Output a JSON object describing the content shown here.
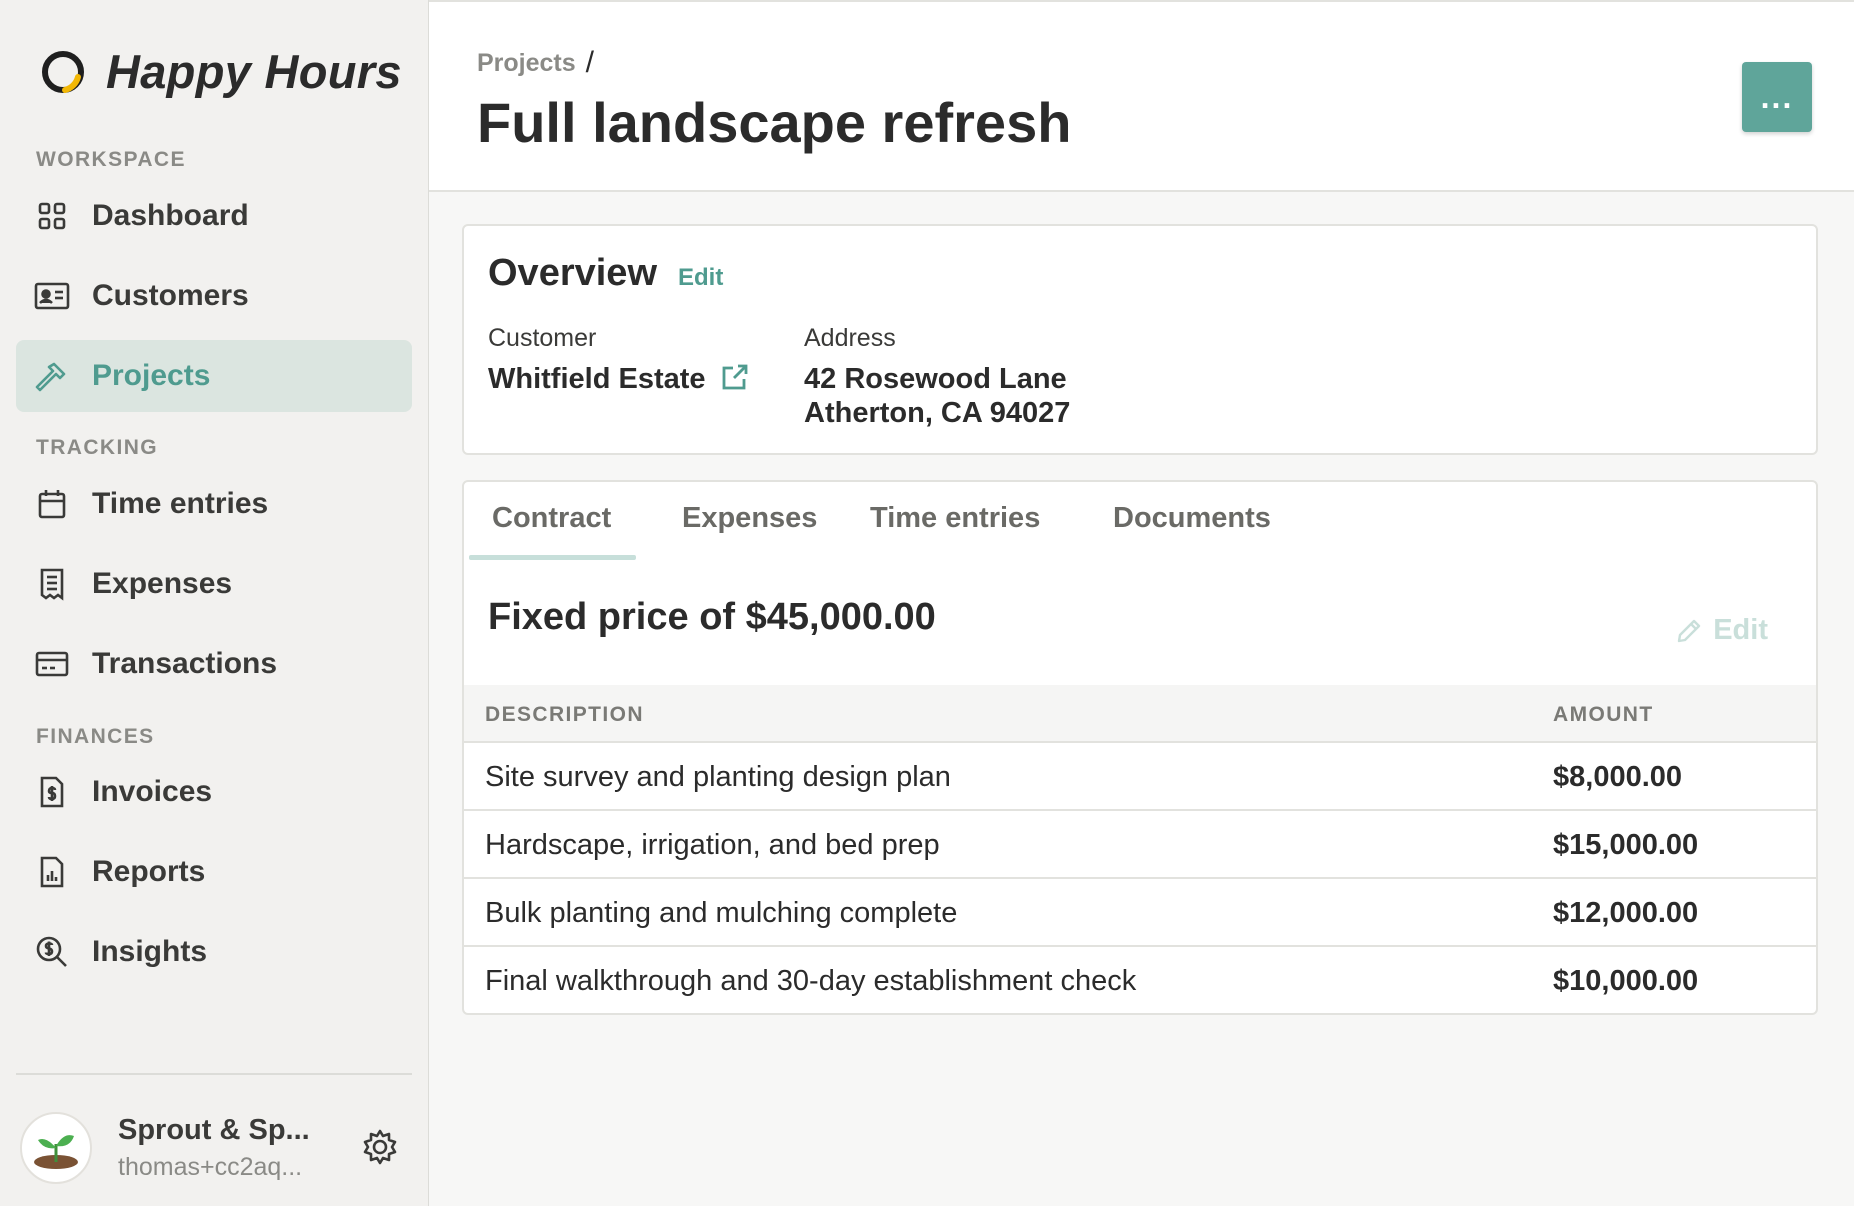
{
  "brand": {
    "name": "Happy Hours",
    "logo_icon": "happy-hours-logo-icon"
  },
  "sidebar": {
    "sections": [
      {
        "label": "WORKSPACE"
      },
      {
        "label": "TRACKING"
      },
      {
        "label": "FINANCES"
      }
    ],
    "items": [
      {
        "label": "Dashboard",
        "icon": "grid-icon"
      },
      {
        "label": "Customers",
        "icon": "id-card-icon"
      },
      {
        "label": "Projects",
        "icon": "hammer-icon",
        "active": true
      },
      {
        "label": "Time entries",
        "icon": "calendar-icon"
      },
      {
        "label": "Expenses",
        "icon": "receipt-icon"
      },
      {
        "label": "Transactions",
        "icon": "credit-card-icon"
      },
      {
        "label": "Invoices",
        "icon": "invoice-dollar-icon"
      },
      {
        "label": "Reports",
        "icon": "report-chart-icon"
      },
      {
        "label": "Insights",
        "icon": "search-dollar-icon"
      }
    ]
  },
  "account": {
    "name": "Sprout & Sp...",
    "email": "thomas+cc2aq...",
    "avatar_icon": "sprout-avatar-icon",
    "settings_icon": "gear-icon"
  },
  "header": {
    "breadcrumb": {
      "parent": "Projects",
      "separator": "/"
    },
    "title": "Full landscape refresh",
    "more_button_label": "...",
    "more_button_color": "#5fa59a"
  },
  "overview": {
    "title": "Overview",
    "edit_label": "Edit",
    "customer_label": "Customer",
    "customer_value": "Whitfield Estate",
    "address_label": "Address",
    "address_line1": "42 Rosewood Lane",
    "address_line2": "Atherton, CA 94027"
  },
  "tabs": [
    {
      "label": "Contract",
      "active": true
    },
    {
      "label": "Expenses"
    },
    {
      "label": "Time entries"
    },
    {
      "label": "Documents"
    }
  ],
  "contract": {
    "title": "Fixed price of $45,000.00",
    "edit_label": "Edit",
    "columns": [
      "DESCRIPTION",
      "AMOUNT"
    ],
    "rows": [
      {
        "description": "Site survey and planting design plan",
        "amount": "$8,000.00"
      },
      {
        "description": "Hardscape, irrigation, and bed prep",
        "amount": "$15,000.00"
      },
      {
        "description": "Bulk planting and mulching complete",
        "amount": "$12,000.00"
      },
      {
        "description": "Final walkthrough and 30-day establishment check",
        "amount": "$10,000.00"
      }
    ]
  },
  "colors": {
    "accent": "#4f9b8f",
    "active_nav_bg": "#dbe5e0",
    "sidebar_bg": "#f2f1ef"
  }
}
